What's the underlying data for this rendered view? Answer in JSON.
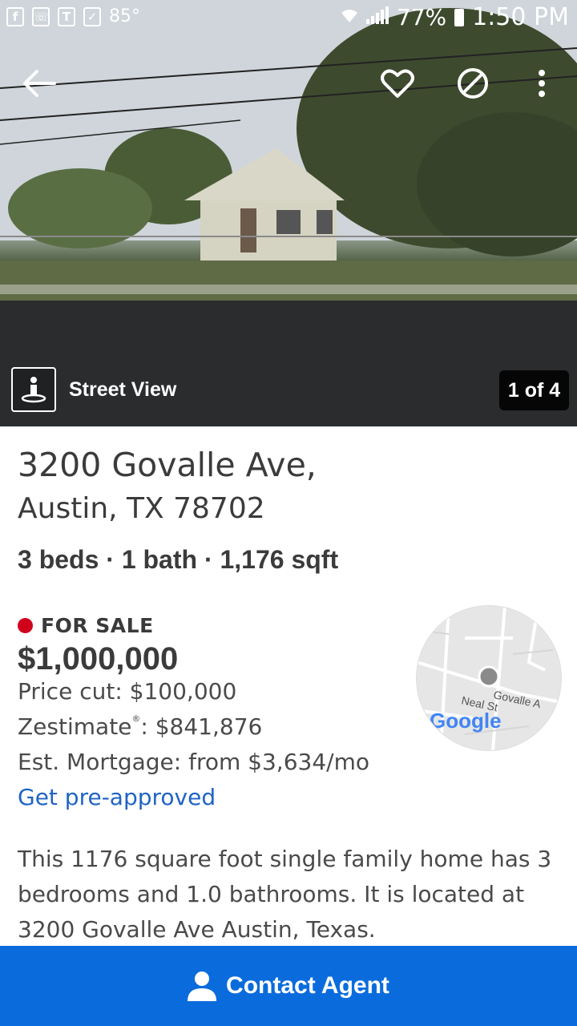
{
  "status_bar": {
    "temperature": "85°",
    "battery": "77%",
    "time": "1:50 PM"
  },
  "toolbar": {
    "back_icon": "arrow-left-icon",
    "favorite_icon": "heart-outline-icon",
    "hide_icon": "block-icon",
    "more_icon": "more-vertical-icon"
  },
  "photo": {
    "street_view_label": "Street View",
    "counter": "1 of 4"
  },
  "listing": {
    "address_line1": "3200 Govalle Ave,",
    "address_line2": "Austin, TX 78702",
    "facts": "3 beds · 1 bath · 1,176 sqft",
    "status": "FOR SALE",
    "status_color": "#d0021b",
    "price": "$1,000,000",
    "price_cut": "Price cut: $100,000",
    "zestimate_label": "Zestimate",
    "zestimate_value": ": $841,876",
    "mortgage": "Est. Mortgage: from $3,634/mo",
    "preapproved_link": "Get pre-approved",
    "description": "This 1176 square foot single family home has 3 bedrooms and 1.0 bathrooms. It is located at 3200 Govalle Ave Austin, Texas."
  },
  "map": {
    "street_label_1": "Govalle A",
    "street_label_2": "Neal St",
    "brand": "Google"
  },
  "contact": {
    "label": "Contact Agent",
    "color": "#0a6cdc"
  }
}
